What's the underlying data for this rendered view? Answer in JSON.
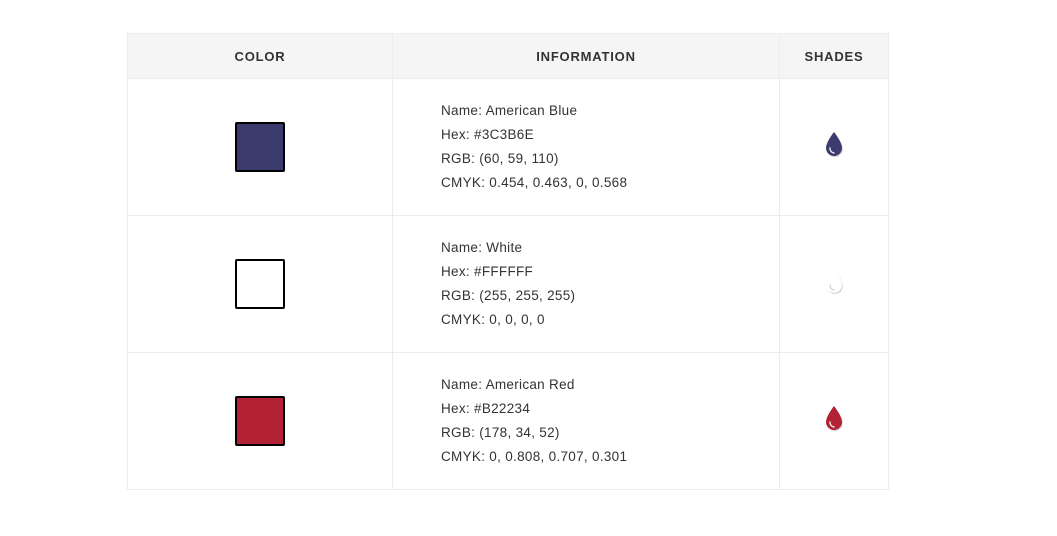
{
  "table": {
    "headers": {
      "color": "COLOR",
      "information": "INFORMATION",
      "shades": "SHADES"
    },
    "rows": [
      {
        "swatch_color": "#3C3B6E",
        "name": "Name: American Blue",
        "hex": "Hex: #3C3B6E",
        "rgb": "RGB: (60, 59, 110)",
        "cmyk": "CMYK: 0.454, 0.463, 0, 0.568",
        "shade_icon": "drop-icon"
      },
      {
        "swatch_color": "#FFFFFF",
        "name": "Name: White",
        "hex": "Hex: #FFFFFF",
        "rgb": "RGB: (255, 255, 255)",
        "cmyk": "CMYK: 0, 0, 0, 0",
        "shade_icon": "drop-icon"
      },
      {
        "swatch_color": "#B22234",
        "name": "Name: American Red",
        "hex": "Hex: #B22234",
        "rgb": "RGB: (178, 34, 52)",
        "cmyk": "CMYK: 0, 0.808, 0.707, 0.301",
        "shade_icon": "drop-icon"
      }
    ]
  }
}
